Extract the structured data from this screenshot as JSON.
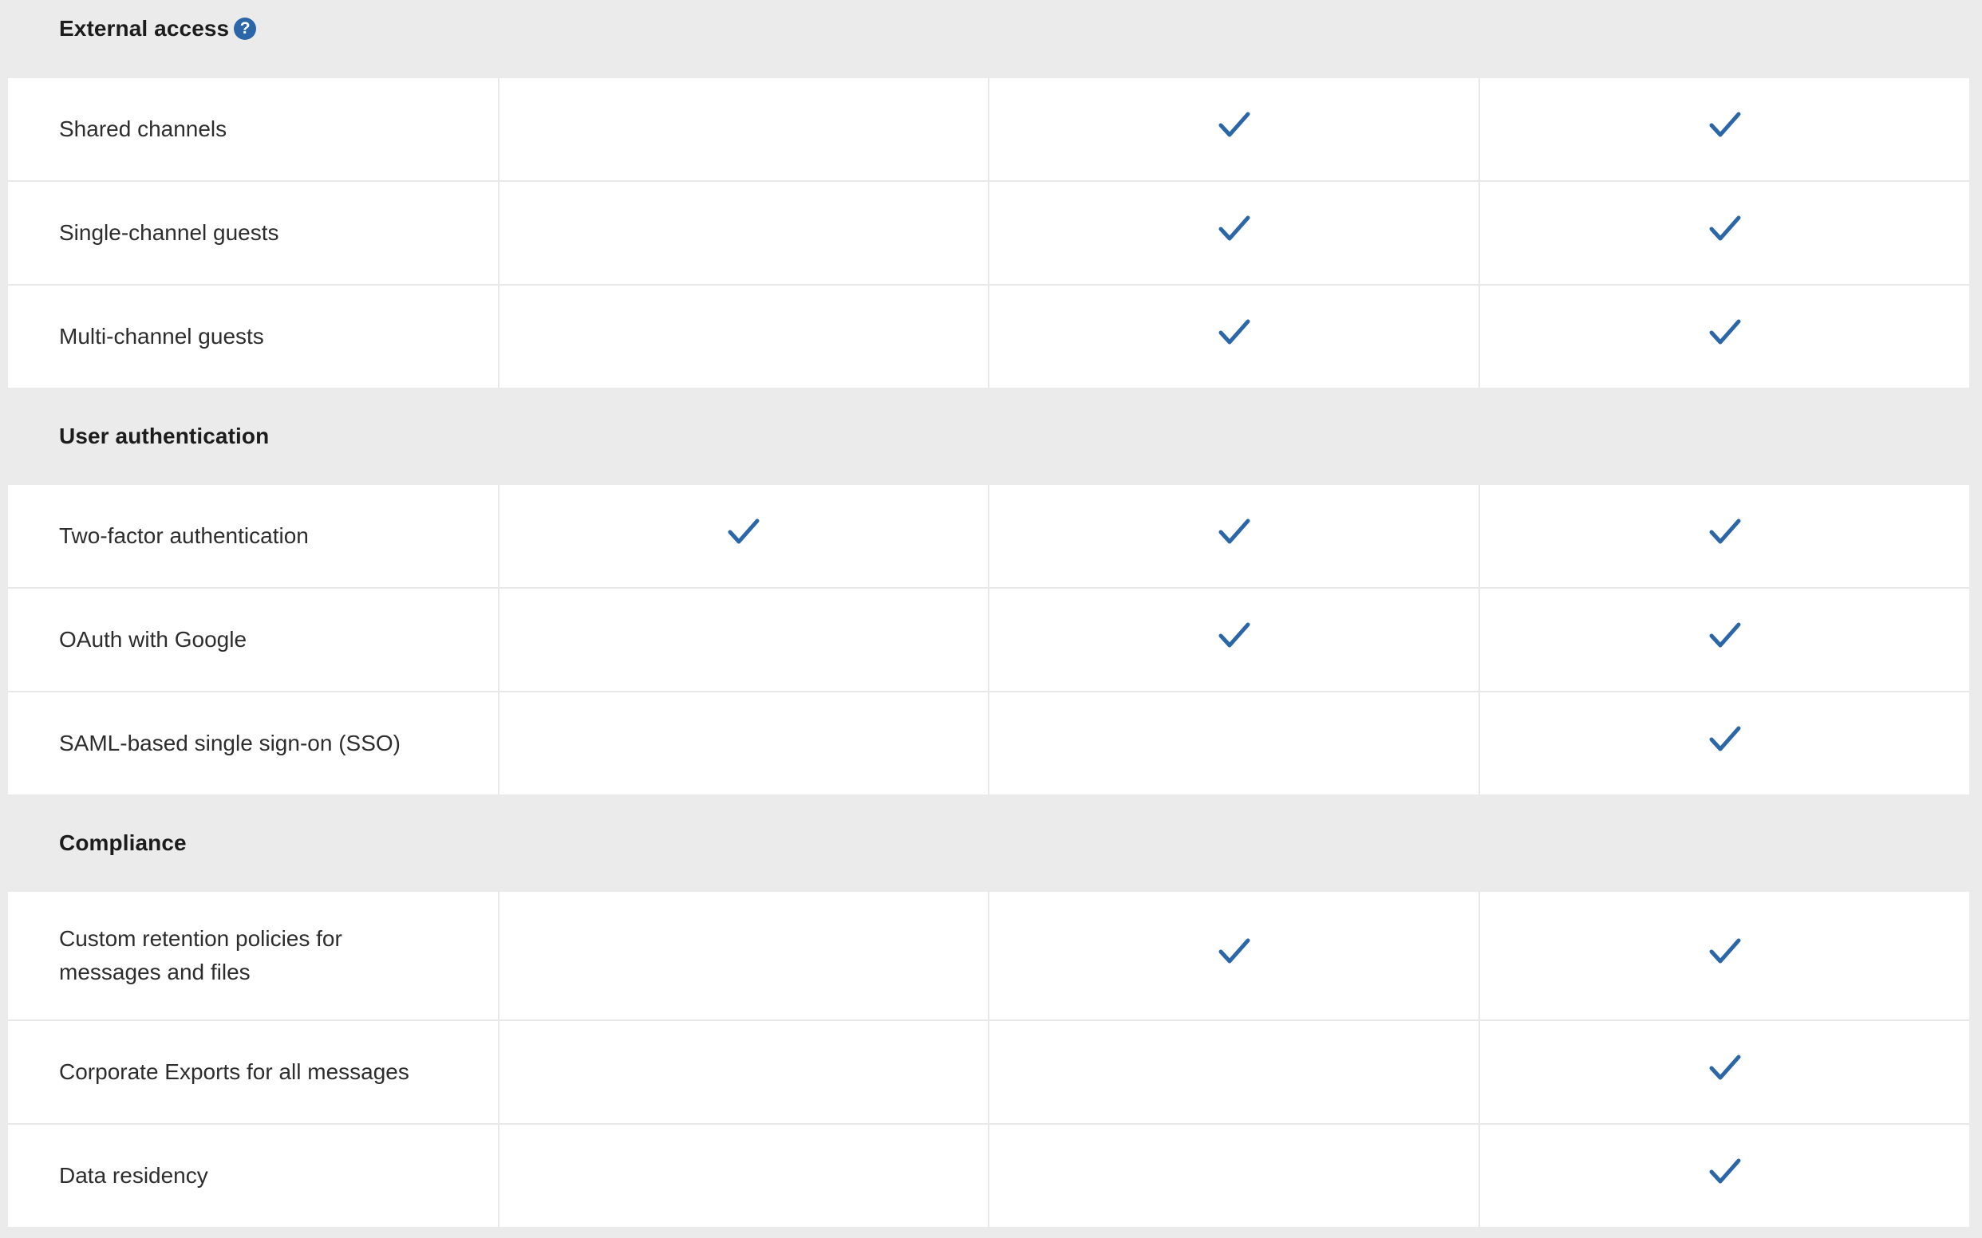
{
  "colors": {
    "check": "#2b67a8",
    "help_icon": "#2b67a8",
    "section_background": "#ebebeb",
    "row_background": "#ffffff",
    "divider": "#e8e8e8"
  },
  "icons": {
    "check": "check-icon",
    "help": "help-circle-icon"
  },
  "help_icon_glyph": "?",
  "sections": [
    {
      "title": "External access",
      "has_help_icon": true,
      "rows": [
        {
          "label": "Shared channels",
          "plans": [
            false,
            true,
            true
          ]
        },
        {
          "label": "Single-channel guests",
          "plans": [
            false,
            true,
            true
          ]
        },
        {
          "label": "Multi-channel guests",
          "plans": [
            false,
            true,
            true
          ]
        }
      ]
    },
    {
      "title": "User authentication",
      "has_help_icon": false,
      "rows": [
        {
          "label": "Two-factor authentication",
          "plans": [
            true,
            true,
            true
          ]
        },
        {
          "label": "OAuth with Google",
          "plans": [
            false,
            true,
            true
          ]
        },
        {
          "label": "SAML-based single sign-on (SSO)",
          "plans": [
            false,
            false,
            true
          ]
        }
      ]
    },
    {
      "title": "Compliance",
      "has_help_icon": false,
      "rows": [
        {
          "label": "Custom retention policies for\nmessages and files",
          "plans": [
            false,
            true,
            true
          ]
        },
        {
          "label": "Corporate Exports for all messages",
          "plans": [
            false,
            false,
            true
          ]
        },
        {
          "label": "Data residency",
          "plans": [
            false,
            false,
            true
          ]
        }
      ]
    }
  ]
}
